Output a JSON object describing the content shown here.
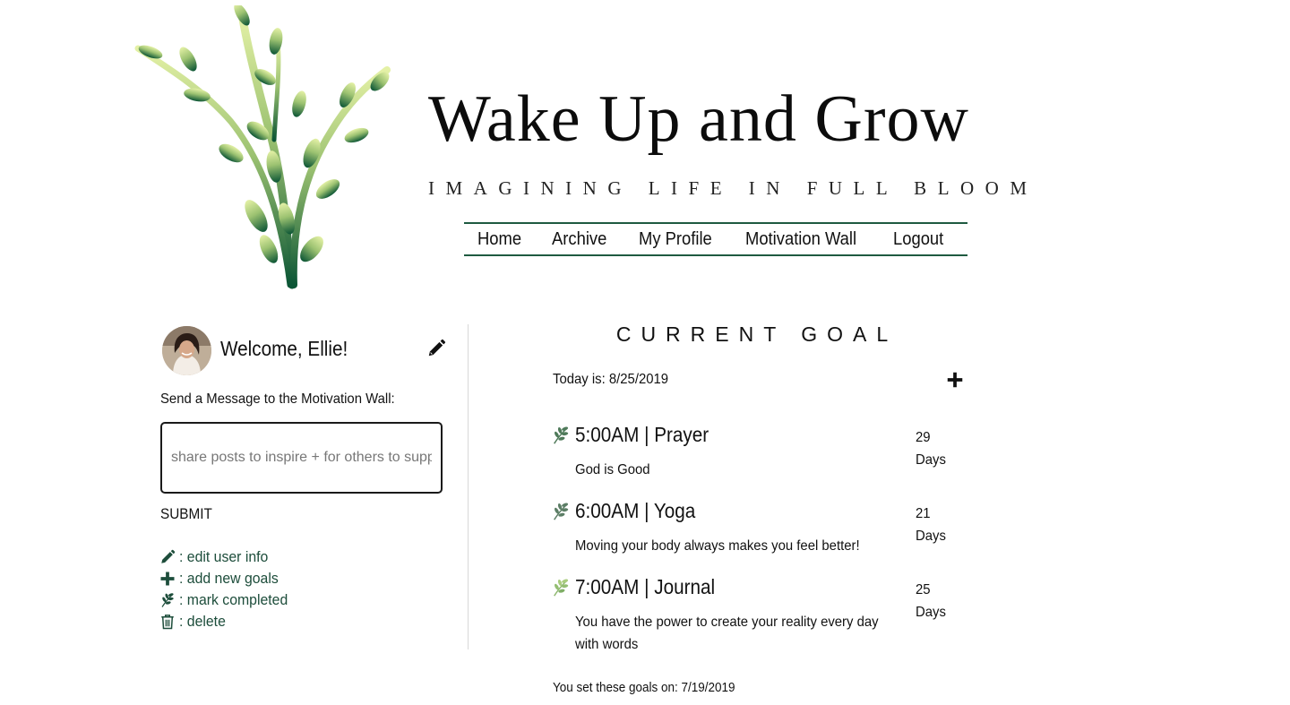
{
  "site": {
    "title": "Wake Up and Grow",
    "tagline": "IMAGINING LIFE IN FULL BLOOM",
    "logo_icon": "sprouting-plant-logo"
  },
  "nav": {
    "items": [
      {
        "label": "Home"
      },
      {
        "label": "Archive"
      },
      {
        "label": "My Profile"
      },
      {
        "label": "Motivation Wall"
      },
      {
        "label": "Logout"
      }
    ]
  },
  "sidebar": {
    "welcome": "Welcome, Ellie!",
    "send_label": "Send a Message to the Motivation Wall:",
    "message_placeholder": "share posts to inspire + for others to support",
    "message_value": "",
    "submit_label": "SUBMIT",
    "legend": [
      {
        "icon": "pencil-icon",
        "label": ": edit user info"
      },
      {
        "icon": "plus-icon",
        "label": ": add new goals"
      },
      {
        "icon": "sprig-icon",
        "label": ": mark completed"
      },
      {
        "icon": "trash-icon",
        "label": ": delete"
      }
    ]
  },
  "goals": {
    "heading": "CURRENT GOAL",
    "today": "Today is: 8/25/2019",
    "items": [
      {
        "title": "5:00AM | Prayer",
        "description": "God is Good",
        "days_count": "29",
        "days_label": "Days"
      },
      {
        "title": "6:00AM | Yoga",
        "description": "Moving your body always makes you feel better!",
        "days_count": "21",
        "days_label": "Days"
      },
      {
        "title": "7:00AM | Journal",
        "description": "You have the power to create your reality every day with words",
        "days_count": "25",
        "days_label": "Days"
      }
    ],
    "set_on": "You set these goals on: 7/19/2019"
  },
  "colors": {
    "accent_green": "#1e5a40",
    "legend_text": "#1d4d3b",
    "leaf_light": "#d9ec9a",
    "leaf_dark": "#0f5a3a"
  }
}
